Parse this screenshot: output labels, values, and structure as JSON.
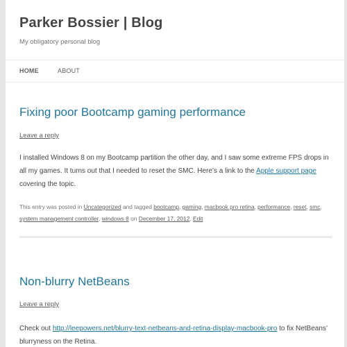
{
  "site": {
    "title": "Parker Bossier | Blog",
    "description": "My obligatory personal blog"
  },
  "nav": {
    "items": [
      {
        "label": "HOME"
      },
      {
        "label": "ABOUT"
      }
    ]
  },
  "posts": [
    {
      "title": "Fixing poor Bootcamp gaming performance",
      "leave_reply": "Leave a reply",
      "body": {
        "text_1": "I installed Windows 8 on my Bootcamp partition the other day, and I saw some extreme FPS drops in all my games. It turns out that I needed to reset the SMC. Here’s a link to the ",
        "link": "Apple support page",
        "text_2": " covering the topic."
      },
      "meta": {
        "posted_in": "This entry was posted in ",
        "category": "Uncategorized",
        "tagged": " and tagged ",
        "tags": [
          "bootcamp",
          "gaming",
          "macbook pro retina",
          "performance",
          "reset",
          "smc",
          "system management controller",
          "windows 8"
        ],
        "on": " on ",
        "date": "December 17, 2012",
        "edit": "Edit"
      }
    },
    {
      "title": "Non-blurry NetBeans",
      "leave_reply": "Leave a reply",
      "body": {
        "text_1": "Check out ",
        "link": "http://leepowers.net/blurry-text-netbeans-and-retina-display-macbook-pro",
        "text_2": " to fix NetBeans’ blurryness on the Retina."
      }
    }
  ],
  "colors": {
    "link": "#21759b",
    "text": "#444444",
    "background": "#e6e6e6"
  }
}
